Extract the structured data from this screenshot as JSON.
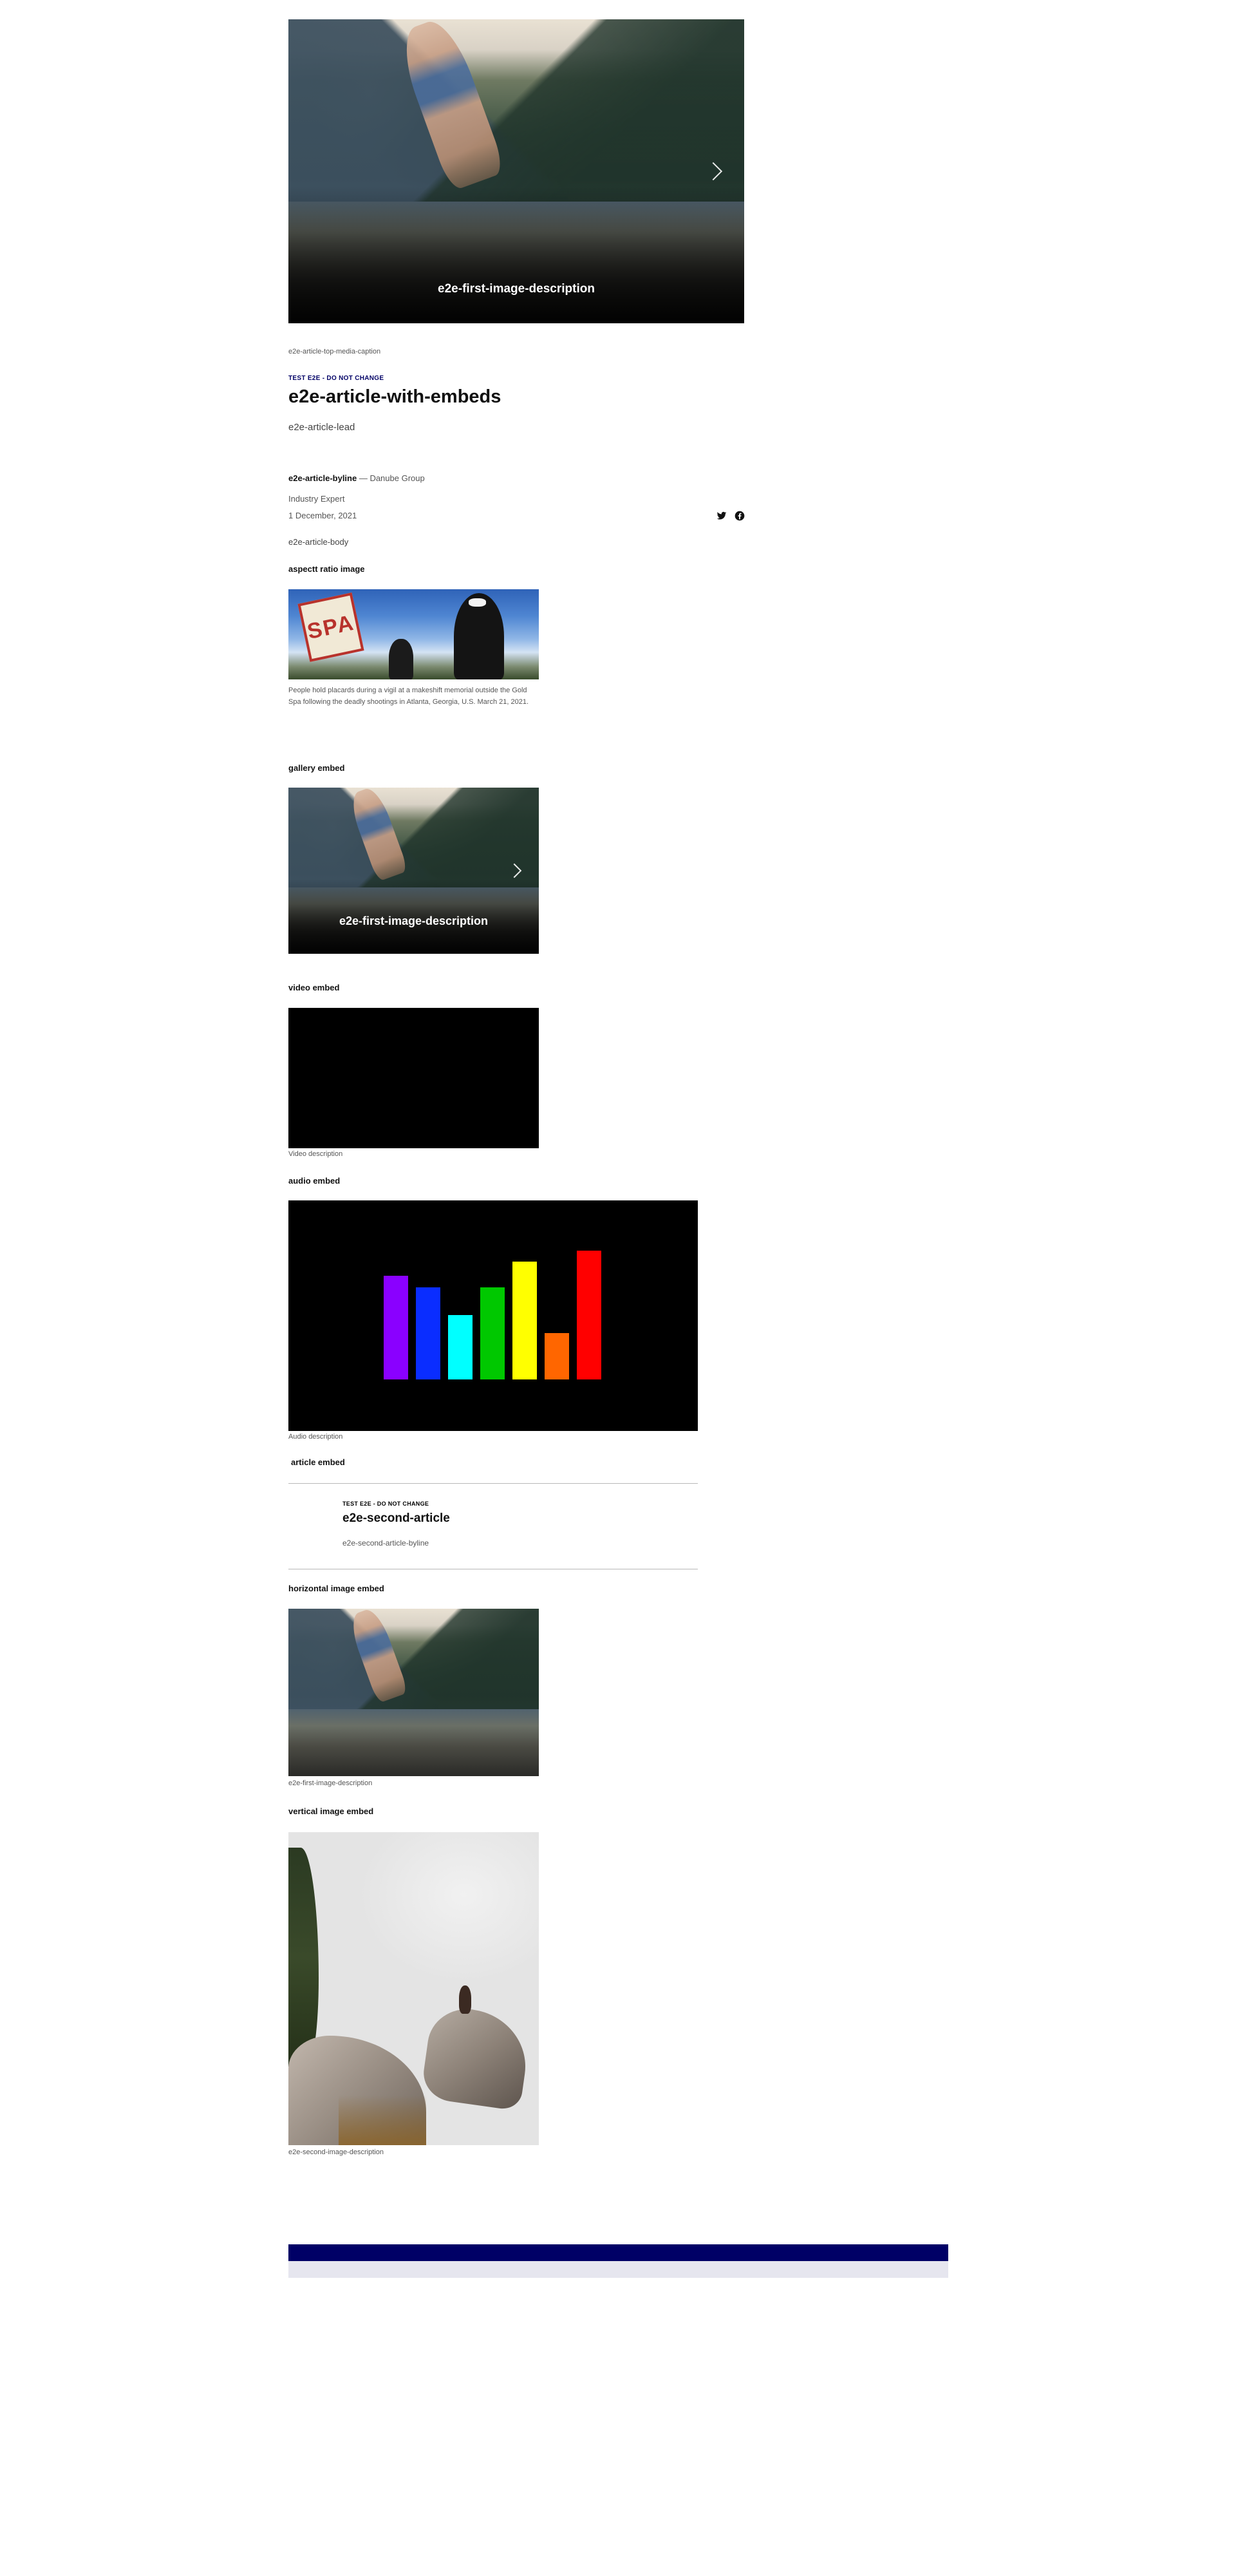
{
  "hero": {
    "caption": "e2e-first-image-description",
    "media_caption": "e2e-article-top-media-caption"
  },
  "article": {
    "kicker": "TEST E2E - DO NOT CHANGE",
    "title": "e2e-article-with-embeds",
    "lead": "e2e-article-lead",
    "byline_name": "e2e-article-byline",
    "byline_org": " — Danube Group",
    "byline_role": "Industry Expert",
    "date": "1 December, 2021",
    "body": "e2e-article-body",
    "share_icons": [
      "twitter-icon",
      "facebook-icon"
    ]
  },
  "aspect_ratio": {
    "heading": "aspectt ratio image",
    "sign_text": "SPA",
    "caption": "People hold placards during a vigil at a makeshift memorial outside the Gold Spa following the deadly shootings in Atlanta, Georgia, U.S. March 21, 2021."
  },
  "gallery": {
    "heading": "gallery embed",
    "caption": "e2e-first-image-description"
  },
  "video": {
    "heading": "video embed",
    "description": "Video description"
  },
  "audio": {
    "heading": "audio embed",
    "description": "Audio description",
    "bars": [
      {
        "color": "#8a00ff",
        "level": 0.45
      },
      {
        "color": "#0a2dff",
        "level": 0.4
      },
      {
        "color": "#00ffff",
        "level": 0.28
      },
      {
        "color": "#00c800",
        "level": 0.4
      },
      {
        "color": "#ffff00",
        "level": 0.51
      },
      {
        "color": "#ff6600",
        "level": 0.2
      },
      {
        "color": "#ff0000",
        "level": 0.56
      }
    ]
  },
  "article_embed": {
    "heading": "article embed",
    "kicker": "TEST E2E - DO NOT CHANGE",
    "title": "e2e-second-article",
    "byline": "e2e-second-article-byline"
  },
  "horizontal": {
    "heading": "horizontal image embed",
    "caption": "e2e-first-image-description"
  },
  "vertical": {
    "heading": "vertical image embed",
    "caption": "e2e-second-image-description"
  },
  "footer": {
    "bar_color": "#000066",
    "sub_color": "#e6e6ef"
  }
}
